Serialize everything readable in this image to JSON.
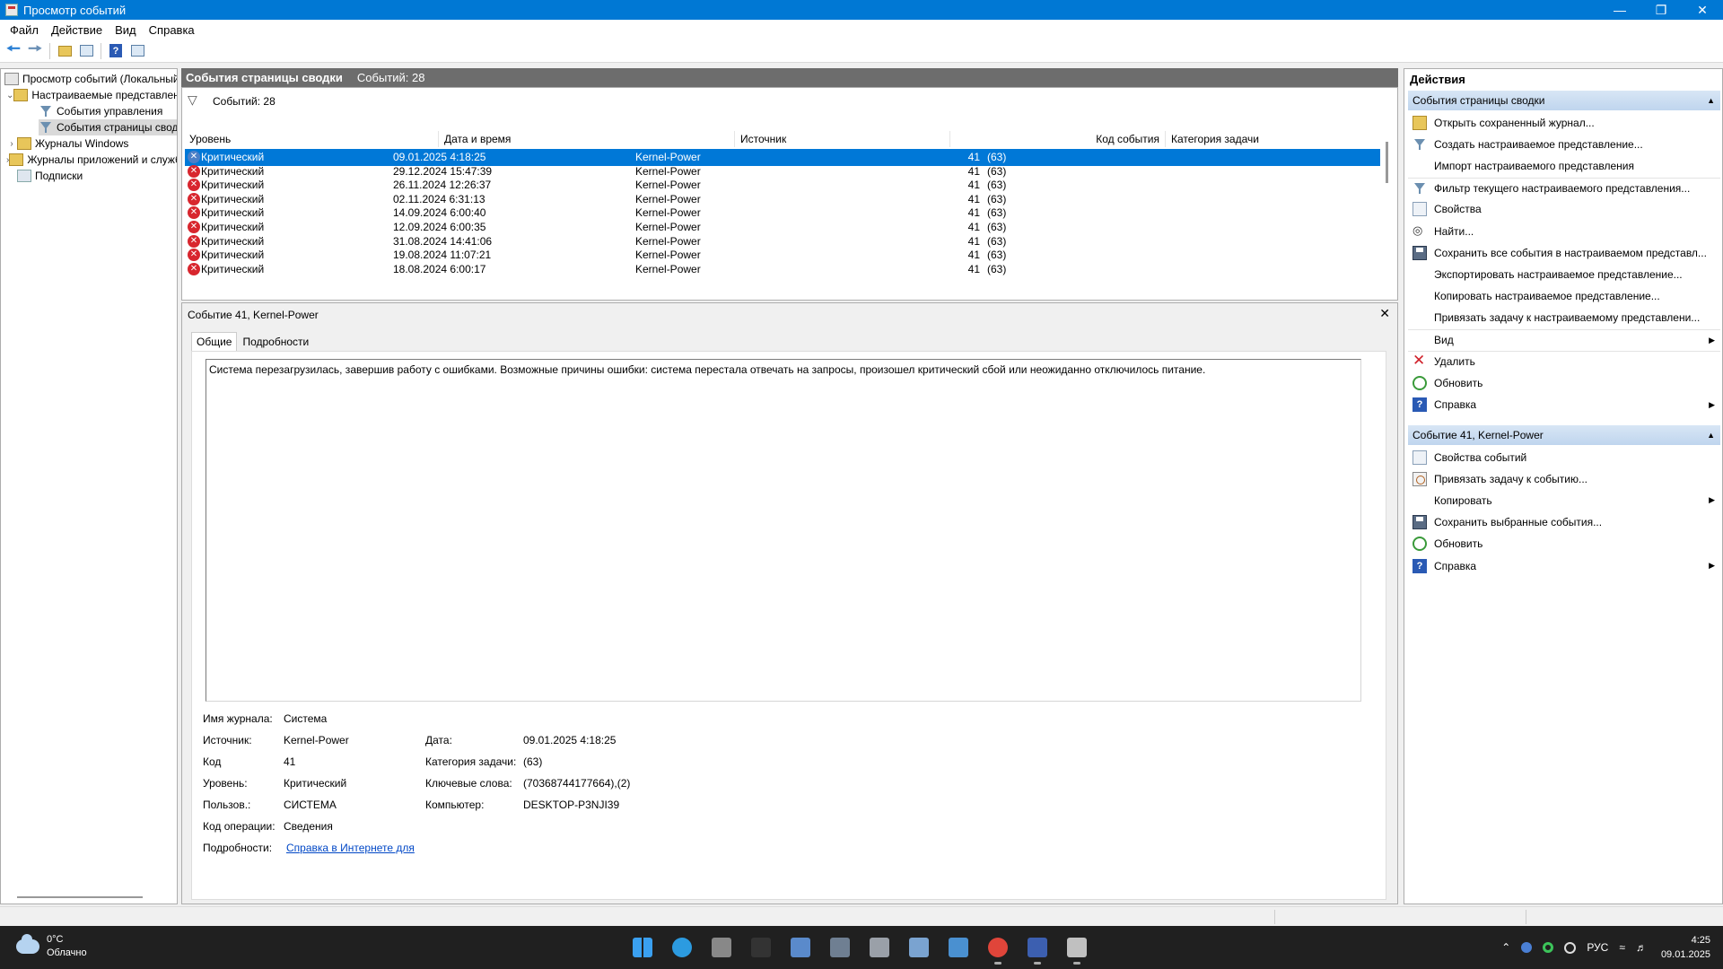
{
  "window": {
    "title": "Просмотр событий",
    "controls": {
      "minimize": "—",
      "restore": "❐",
      "close": "✕"
    }
  },
  "menu": [
    "Файл",
    "Действие",
    "Вид",
    "Справка"
  ],
  "toolbar_icons": [
    "back-arrow-icon",
    "forward-arrow-icon",
    "folder-up-icon",
    "show-hide-tree-icon",
    "help-icon",
    "show-hide-action-pane-icon"
  ],
  "tree": {
    "root": "Просмотр событий (Локальный)",
    "custom_views": "Настраиваемые представления",
    "admin_events": "События управления",
    "summary_events": "События страницы сводки",
    "windows_logs": "Журналы Windows",
    "app_logs": "Журналы приложений и служб",
    "subscriptions": "Подписки"
  },
  "center": {
    "header_name": "События страницы сводки",
    "header_count": "Событий: 28",
    "filter_text": "Событий: 28",
    "columns": {
      "level": "Уровень",
      "datetime": "Дата и время",
      "source": "Источник",
      "event_id": "Код события",
      "category": "Категория задачи"
    },
    "rows": [
      {
        "level": "Критический",
        "datetime": "09.01.2025 4:18:25",
        "source": "Kernel-Power",
        "id": "41",
        "category": "(63)"
      },
      {
        "level": "Критический",
        "datetime": "29.12.2024 15:47:39",
        "source": "Kernel-Power",
        "id": "41",
        "category": "(63)"
      },
      {
        "level": "Критический",
        "datetime": "26.11.2024 12:26:37",
        "source": "Kernel-Power",
        "id": "41",
        "category": "(63)"
      },
      {
        "level": "Критический",
        "datetime": "02.11.2024 6:31:13",
        "source": "Kernel-Power",
        "id": "41",
        "category": "(63)"
      },
      {
        "level": "Критический",
        "datetime": "14.09.2024 6:00:40",
        "source": "Kernel-Power",
        "id": "41",
        "category": "(63)"
      },
      {
        "level": "Критический",
        "datetime": "12.09.2024 6:00:35",
        "source": "Kernel-Power",
        "id": "41",
        "category": "(63)"
      },
      {
        "level": "Критический",
        "datetime": "31.08.2024 14:41:06",
        "source": "Kernel-Power",
        "id": "41",
        "category": "(63)"
      },
      {
        "level": "Критический",
        "datetime": "19.08.2024 11:07:21",
        "source": "Kernel-Power",
        "id": "41",
        "category": "(63)"
      },
      {
        "level": "Критический",
        "datetime": "18.08.2024 6:00:17",
        "source": "Kernel-Power",
        "id": "41",
        "category": "(63)"
      }
    ]
  },
  "detail": {
    "title": "Событие 41, Kernel-Power",
    "close": "✕",
    "tabs": [
      "Общие",
      "Подробности"
    ],
    "description": "Система перезагрузилась, завершив работу с ошибками. Возможные причины ошибки: система перестала отвечать на запросы, произошел критический сбой или неожиданно отключилось питание.",
    "props": {
      "log_name_label": "Имя журнала:",
      "log_name": "Система",
      "source_label": "Источник:",
      "source": "Kernel-Power",
      "date_label": "Дата:",
      "date": "09.01.2025 4:18:25",
      "code_label": "Код",
      "code": "41",
      "task_cat_label": "Категория задачи:",
      "task_cat": "(63)",
      "level_label": "Уровень:",
      "level": "Критический",
      "keywords_label": "Ключевые слова:",
      "keywords": "(70368744177664),(2)",
      "user_label": "Пользов.:",
      "user": "СИСТЕМА",
      "computer_label": "Компьютер:",
      "computer": "DESKTOP-P3NJI39",
      "opcode_label": "Код операции:",
      "opcode": "Сведения",
      "more_label": "Подробности:",
      "more_link": "Справка в Интернете для"
    }
  },
  "actions": {
    "title": "Действия",
    "section1": {
      "title": "События страницы сводки",
      "items": [
        {
          "label": "Открыть сохраненный журнал...",
          "icon": "open-log-icon"
        },
        {
          "label": "Создать настраиваемое представление...",
          "icon": "filter-icon"
        },
        {
          "label": "Импорт настраиваемого представления",
          "icon": "none"
        },
        {
          "label": "Фильтр текущего настраиваемого представления...",
          "icon": "filter-icon"
        },
        {
          "label": "Свойства",
          "icon": "properties-icon"
        },
        {
          "label": "Найти...",
          "icon": "find-icon"
        },
        {
          "label": "Сохранить все события в настраиваемом представл...",
          "icon": "save-icon"
        },
        {
          "label": "Экспортировать настраиваемое представление...",
          "icon": "none"
        },
        {
          "label": "Копировать настраиваемое представление...",
          "icon": "none"
        },
        {
          "label": "Привязать задачу к настраиваемому представлени...",
          "icon": "none"
        },
        {
          "label": "Вид",
          "icon": "none",
          "submenu": true
        },
        {
          "label": "Удалить",
          "icon": "delete-icon"
        },
        {
          "label": "Обновить",
          "icon": "refresh-icon"
        },
        {
          "label": "Справка",
          "icon": "help-icon",
          "submenu": true
        }
      ]
    },
    "section2": {
      "title": "Событие 41, Kernel-Power",
      "items": [
        {
          "label": "Свойства событий",
          "icon": "properties-icon"
        },
        {
          "label": "Привязать задачу к событию...",
          "icon": "task-icon"
        },
        {
          "label": "Копировать",
          "icon": "copy-icon",
          "submenu": true
        },
        {
          "label": "Сохранить выбранные события...",
          "icon": "save-icon"
        },
        {
          "label": "Обновить",
          "icon": "refresh-icon"
        },
        {
          "label": "Справка",
          "icon": "help-icon",
          "submenu": true
        }
      ]
    }
  },
  "taskbar": {
    "temp": "0°C",
    "weather": "Облачно",
    "lang": "РУС",
    "time": "4:25",
    "date": "09.01.2025",
    "apps": [
      {
        "name": "start-icon",
        "color": "#3aa0f0"
      },
      {
        "name": "edge-icon",
        "color": "#2c9be0"
      },
      {
        "name": "clapper-icon",
        "color": "#888888"
      },
      {
        "name": "terminal-icon",
        "color": "#333333"
      },
      {
        "name": "media-icon",
        "color": "#5a8acb"
      },
      {
        "name": "calculator-icon",
        "color": "#6f7f92"
      },
      {
        "name": "mouse-icon",
        "color": "#9aa0a8"
      },
      {
        "name": "monitor-icon",
        "color": "#7aa3d0"
      },
      {
        "name": "remote-desktop-icon",
        "color": "#4a90d0"
      },
      {
        "name": "chrome-icon",
        "color": "#e0453a"
      },
      {
        "name": "floppy-icon",
        "color": "#3c5fb0"
      },
      {
        "name": "event-viewer-icon",
        "color": "#c0c0c0"
      }
    ]
  }
}
